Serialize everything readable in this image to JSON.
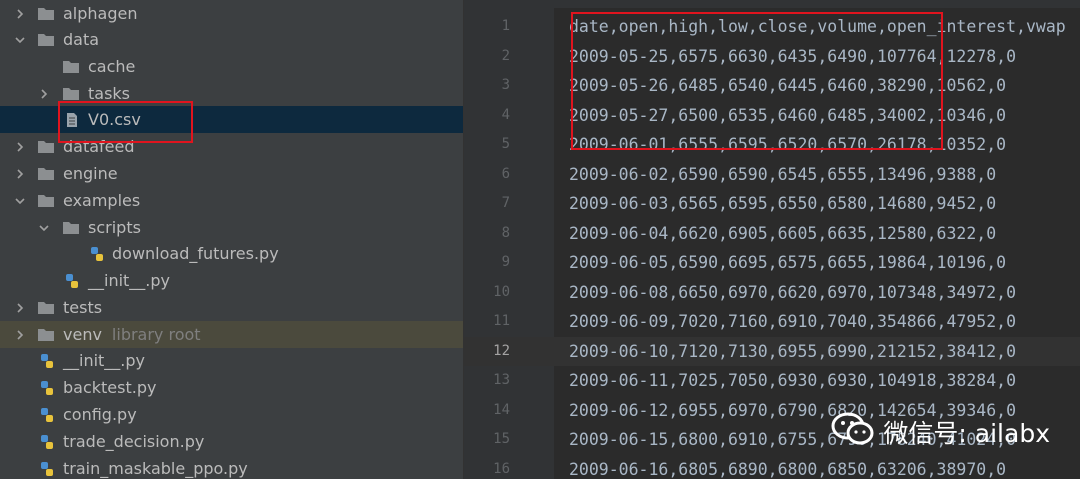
{
  "sidebar": {
    "items": [
      {
        "label": "alphagen",
        "kind": "folder",
        "expanded": false
      },
      {
        "label": "data",
        "kind": "folder",
        "expanded": true
      },
      {
        "label": "cache",
        "kind": "folder"
      },
      {
        "label": "tasks",
        "kind": "folder",
        "expanded": false
      },
      {
        "label": "V0.csv",
        "kind": "csv-file",
        "selected": true
      },
      {
        "label": "datafeed",
        "kind": "folder",
        "expanded": false
      },
      {
        "label": "engine",
        "kind": "folder",
        "expanded": false
      },
      {
        "label": "examples",
        "kind": "folder",
        "expanded": true
      },
      {
        "label": "scripts",
        "kind": "folder",
        "expanded": true
      },
      {
        "label": "download_futures.py",
        "kind": "python-file"
      },
      {
        "label": "__init__.py",
        "kind": "python-file"
      },
      {
        "label": "tests",
        "kind": "folder",
        "expanded": false
      },
      {
        "label": "venv",
        "kind": "folder",
        "expanded": false,
        "hint": "library root"
      },
      {
        "label": "__init__.py",
        "kind": "python-file"
      },
      {
        "label": "backtest.py",
        "kind": "python-file"
      },
      {
        "label": "config.py",
        "kind": "python-file"
      },
      {
        "label": "trade_decision.py",
        "kind": "python-file"
      },
      {
        "label": "train_maskable_ppo.py",
        "kind": "python-file"
      }
    ]
  },
  "editor": {
    "current_line": 12,
    "lines": [
      {
        "num": "1",
        "text": "date,open,high,low,close,volume,open_interest,vwap"
      },
      {
        "num": "2",
        "text": "2009-05-25,6575,6630,6435,6490,107764,12278,0"
      },
      {
        "num": "3",
        "text": "2009-05-26,6485,6540,6445,6460,38290,10562,0"
      },
      {
        "num": "4",
        "text": "2009-05-27,6500,6535,6460,6485,34002,10346,0"
      },
      {
        "num": "5",
        "text": "2009-06-01,6555,6595,6520,6570,26178,10352,0"
      },
      {
        "num": "6",
        "text": "2009-06-02,6590,6590,6545,6555,13496,9388,0"
      },
      {
        "num": "7",
        "text": "2009-06-03,6565,6595,6550,6580,14680,9452,0"
      },
      {
        "num": "8",
        "text": "2009-06-04,6620,6905,6605,6635,12580,6322,0"
      },
      {
        "num": "9",
        "text": "2009-06-05,6590,6695,6575,6655,19864,10196,0"
      },
      {
        "num": "10",
        "text": "2009-06-08,6650,6970,6620,6970,107348,34972,0"
      },
      {
        "num": "11",
        "text": "2009-06-09,7020,7160,6910,7040,354866,47952,0"
      },
      {
        "num": "12",
        "text": "2009-06-10,7120,7130,6955,6990,212152,38412,0"
      },
      {
        "num": "13",
        "text": "2009-06-11,7025,7050,6930,6930,104918,38284,0"
      },
      {
        "num": "14",
        "text": "2009-06-12,6955,6970,6790,6820,142654,39346,0"
      },
      {
        "num": "15",
        "text": "2009-06-15,6800,6910,6755,6790,178240,41024,0"
      },
      {
        "num": "16",
        "text": "2009-06-16,6805,6890,6800,6850,63206,38970,0"
      }
    ]
  },
  "watermark": {
    "text": "微信号: ailabx",
    "icon": "wechat-icon"
  },
  "colors": {
    "sidebar_bg": "#3c3f41",
    "editor_bg": "#2b2b2b",
    "selection": "#0d293e",
    "highlight_box": "#e0141e",
    "code_text": "#a9b7c6"
  }
}
